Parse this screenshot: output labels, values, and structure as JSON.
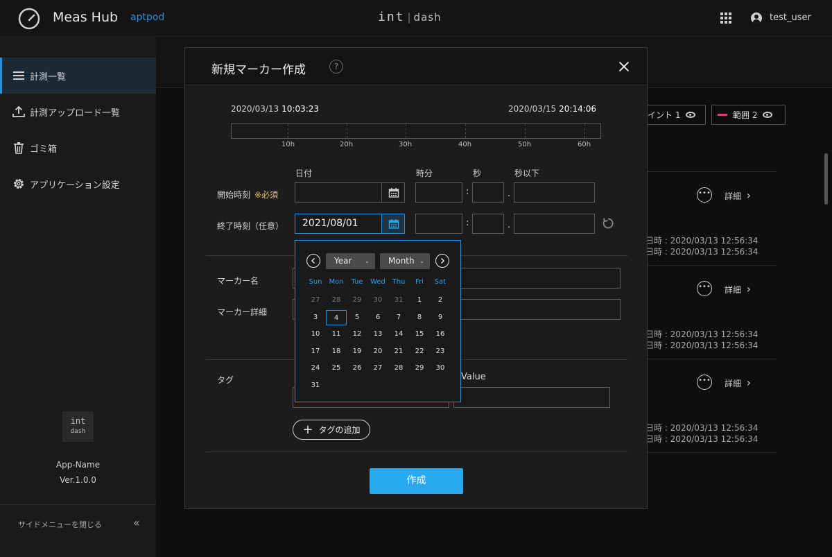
{
  "header": {
    "app_title": "Meas Hub",
    "org_name": "aptpod",
    "brand_main": "int",
    "brand_sub": "dash",
    "user_name": "test_user",
    "apps_icon": "grid-apps-icon",
    "user_icon": "user-circle-icon"
  },
  "sidebar": {
    "items": [
      {
        "label": "計測一覧",
        "icon": "list-icon",
        "active": true
      },
      {
        "label": "計測アップロード一覧",
        "icon": "upload-icon",
        "active": false
      },
      {
        "label": "ゴミ箱",
        "icon": "trash-icon",
        "active": false
      },
      {
        "label": "アプリケーション設定",
        "icon": "gear-icon",
        "active": false
      }
    ],
    "logo_main": "int",
    "logo_sub": "dash",
    "app_name": "App-Name",
    "version": "Ver.1.0.0",
    "close_label": "サイドメニューを閉じる",
    "close_chevron": "«"
  },
  "background": {
    "pill_point": "イント 1",
    "pill_range": "範囲 2",
    "detail_label": "詳細",
    "detail_chevron": "›",
    "row_dates": [
      {
        "line1": "日時 : 2020/03/13 12:56:34",
        "line2": "日時 : 2020/03/13 12:56:34"
      },
      {
        "line1": "日時 : 2020/03/13 12:56:34",
        "line2": "日時 : 2020/03/13 12:56:34"
      },
      {
        "line1": "日時 : 2020/03/13 12:56:34",
        "line2": "日時 : 2020/03/13 12:56:34"
      }
    ]
  },
  "modal": {
    "title": "新規マーカー作成",
    "help_glyph": "?",
    "timeline": {
      "start_date": "2020/03/13",
      "start_time": "10:03:23",
      "end_date": "2020/03/15",
      "end_time": "20:14:06",
      "ticks": [
        "10h",
        "20h",
        "30h",
        "40h",
        "50h",
        "60h"
      ]
    },
    "columns": {
      "date": "日付",
      "hour_min": "時分",
      "sec": "秒",
      "subsec": "秒以下"
    },
    "start_label": "開始時刻",
    "required_label": "※必須",
    "end_label": "終了時刻（任意）",
    "end_date_value": "2021/08/01",
    "colon": ":",
    "dot": ".",
    "marker_name_label": "マーカー名",
    "marker_detail_label": "マーカー詳細",
    "tag_label": "タグ",
    "value_label": "Value",
    "add_tag_plus": "+",
    "add_tag_label": "タグの追加",
    "create_label": "作成"
  },
  "calendar": {
    "year_label": "Year",
    "month_label": "Month",
    "caret": "⌄",
    "weekdays": [
      "Sun",
      "Mon",
      "Tue",
      "Wed",
      "Thu",
      "Fri",
      "Sat"
    ],
    "weeks": [
      [
        "27",
        "28",
        "29",
        "30",
        "31",
        "1",
        "2"
      ],
      [
        "3",
        "4",
        "5",
        "6",
        "7",
        "8",
        "9"
      ],
      [
        "10",
        "11",
        "12",
        "13",
        "14",
        "15",
        "16"
      ],
      [
        "17",
        "18",
        "19",
        "20",
        "21",
        "22",
        "23"
      ],
      [
        "24",
        "25",
        "26",
        "27",
        "28",
        "29",
        "30"
      ],
      [
        "31"
      ]
    ],
    "muted_count": 5,
    "today": "4",
    "accent": "#2d8fd6"
  },
  "colors": {
    "accent": "#2d8fd6",
    "primary_button": "#29a9f0",
    "required": "#e6c84a",
    "range_marker": "#d9456a"
  }
}
